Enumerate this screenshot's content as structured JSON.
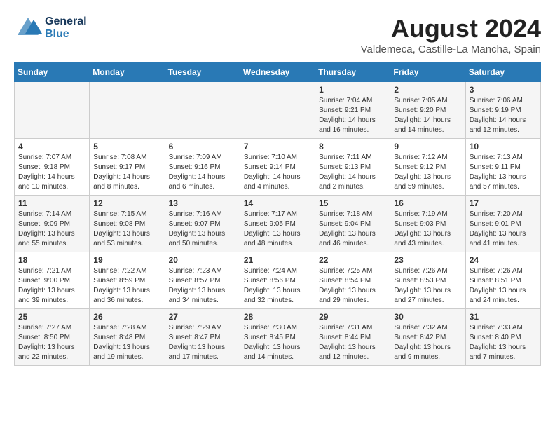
{
  "header": {
    "logo_general": "General",
    "logo_blue": "Blue",
    "month_year": "August 2024",
    "location": "Valdemeca, Castille-La Mancha, Spain"
  },
  "days_of_week": [
    "Sunday",
    "Monday",
    "Tuesday",
    "Wednesday",
    "Thursday",
    "Friday",
    "Saturday"
  ],
  "weeks": [
    [
      {
        "day": "",
        "info": ""
      },
      {
        "day": "",
        "info": ""
      },
      {
        "day": "",
        "info": ""
      },
      {
        "day": "",
        "info": ""
      },
      {
        "day": "1",
        "info": "Sunrise: 7:04 AM\nSunset: 9:21 PM\nDaylight: 14 hours and 16 minutes."
      },
      {
        "day": "2",
        "info": "Sunrise: 7:05 AM\nSunset: 9:20 PM\nDaylight: 14 hours and 14 minutes."
      },
      {
        "day": "3",
        "info": "Sunrise: 7:06 AM\nSunset: 9:19 PM\nDaylight: 14 hours and 12 minutes."
      }
    ],
    [
      {
        "day": "4",
        "info": "Sunrise: 7:07 AM\nSunset: 9:18 PM\nDaylight: 14 hours and 10 minutes."
      },
      {
        "day": "5",
        "info": "Sunrise: 7:08 AM\nSunset: 9:17 PM\nDaylight: 14 hours and 8 minutes."
      },
      {
        "day": "6",
        "info": "Sunrise: 7:09 AM\nSunset: 9:16 PM\nDaylight: 14 hours and 6 minutes."
      },
      {
        "day": "7",
        "info": "Sunrise: 7:10 AM\nSunset: 9:14 PM\nDaylight: 14 hours and 4 minutes."
      },
      {
        "day": "8",
        "info": "Sunrise: 7:11 AM\nSunset: 9:13 PM\nDaylight: 14 hours and 2 minutes."
      },
      {
        "day": "9",
        "info": "Sunrise: 7:12 AM\nSunset: 9:12 PM\nDaylight: 13 hours and 59 minutes."
      },
      {
        "day": "10",
        "info": "Sunrise: 7:13 AM\nSunset: 9:11 PM\nDaylight: 13 hours and 57 minutes."
      }
    ],
    [
      {
        "day": "11",
        "info": "Sunrise: 7:14 AM\nSunset: 9:09 PM\nDaylight: 13 hours and 55 minutes."
      },
      {
        "day": "12",
        "info": "Sunrise: 7:15 AM\nSunset: 9:08 PM\nDaylight: 13 hours and 53 minutes."
      },
      {
        "day": "13",
        "info": "Sunrise: 7:16 AM\nSunset: 9:07 PM\nDaylight: 13 hours and 50 minutes."
      },
      {
        "day": "14",
        "info": "Sunrise: 7:17 AM\nSunset: 9:05 PM\nDaylight: 13 hours and 48 minutes."
      },
      {
        "day": "15",
        "info": "Sunrise: 7:18 AM\nSunset: 9:04 PM\nDaylight: 13 hours and 46 minutes."
      },
      {
        "day": "16",
        "info": "Sunrise: 7:19 AM\nSunset: 9:03 PM\nDaylight: 13 hours and 43 minutes."
      },
      {
        "day": "17",
        "info": "Sunrise: 7:20 AM\nSunset: 9:01 PM\nDaylight: 13 hours and 41 minutes."
      }
    ],
    [
      {
        "day": "18",
        "info": "Sunrise: 7:21 AM\nSunset: 9:00 PM\nDaylight: 13 hours and 39 minutes."
      },
      {
        "day": "19",
        "info": "Sunrise: 7:22 AM\nSunset: 8:59 PM\nDaylight: 13 hours and 36 minutes."
      },
      {
        "day": "20",
        "info": "Sunrise: 7:23 AM\nSunset: 8:57 PM\nDaylight: 13 hours and 34 minutes."
      },
      {
        "day": "21",
        "info": "Sunrise: 7:24 AM\nSunset: 8:56 PM\nDaylight: 13 hours and 32 minutes."
      },
      {
        "day": "22",
        "info": "Sunrise: 7:25 AM\nSunset: 8:54 PM\nDaylight: 13 hours and 29 minutes."
      },
      {
        "day": "23",
        "info": "Sunrise: 7:26 AM\nSunset: 8:53 PM\nDaylight: 13 hours and 27 minutes."
      },
      {
        "day": "24",
        "info": "Sunrise: 7:26 AM\nSunset: 8:51 PM\nDaylight: 13 hours and 24 minutes."
      }
    ],
    [
      {
        "day": "25",
        "info": "Sunrise: 7:27 AM\nSunset: 8:50 PM\nDaylight: 13 hours and 22 minutes."
      },
      {
        "day": "26",
        "info": "Sunrise: 7:28 AM\nSunset: 8:48 PM\nDaylight: 13 hours and 19 minutes."
      },
      {
        "day": "27",
        "info": "Sunrise: 7:29 AM\nSunset: 8:47 PM\nDaylight: 13 hours and 17 minutes."
      },
      {
        "day": "28",
        "info": "Sunrise: 7:30 AM\nSunset: 8:45 PM\nDaylight: 13 hours and 14 minutes."
      },
      {
        "day": "29",
        "info": "Sunrise: 7:31 AM\nSunset: 8:44 PM\nDaylight: 13 hours and 12 minutes."
      },
      {
        "day": "30",
        "info": "Sunrise: 7:32 AM\nSunset: 8:42 PM\nDaylight: 13 hours and 9 minutes."
      },
      {
        "day": "31",
        "info": "Sunrise: 7:33 AM\nSunset: 8:40 PM\nDaylight: 13 hours and 7 minutes."
      }
    ]
  ]
}
